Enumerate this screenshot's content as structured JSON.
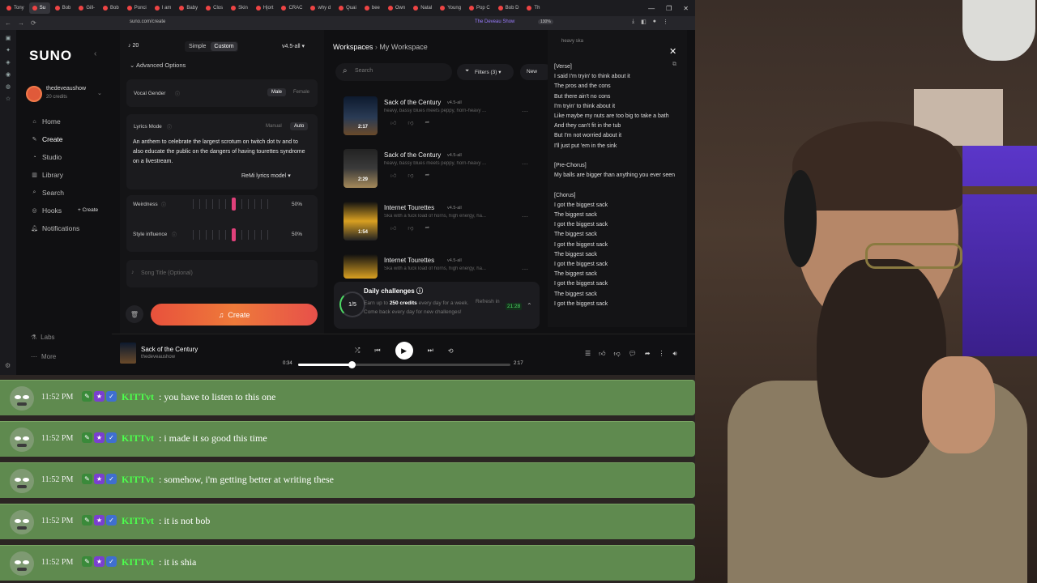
{
  "browser": {
    "tabs": [
      "Tony",
      "Su",
      "Bob",
      "Gill-",
      "Bob",
      "Ponci",
      "I am",
      "Baby",
      "Clos",
      "Skin",
      "Hjort",
      "CRAC",
      "why d",
      "Quai",
      "bee",
      "Own",
      "Natal",
      "Young",
      "Pop C",
      "Bob D",
      "Th"
    ],
    "url": "suno.com/create",
    "stream_tag": "The Deveau Show",
    "zoom": "130%"
  },
  "sidebar": {
    "logo": "SUNO",
    "username": "thedeveaushow",
    "credits": "20 credits",
    "nav": [
      {
        "label": "Home",
        "icon": "home-icon"
      },
      {
        "label": "Create",
        "icon": "create-icon"
      },
      {
        "label": "Studio",
        "icon": "studio-icon"
      },
      {
        "label": "Library",
        "icon": "library-icon"
      },
      {
        "label": "Search",
        "icon": "search-icon"
      },
      {
        "label": "Hooks",
        "icon": "hooks-icon"
      },
      {
        "label": "Notifications",
        "icon": "bell-icon"
      }
    ],
    "hooks_create": "+ Create",
    "labs": "Labs",
    "more": "More"
  },
  "create": {
    "credit_count": "20",
    "mode_simple": "Simple",
    "mode_custom": "Custom",
    "version": "v4.5-all",
    "advanced_options": "Advanced Options",
    "vocal_gender_label": "Vocal Gender",
    "vocal_male": "Male",
    "vocal_female": "Female",
    "lyrics_mode_label": "Lyrics Mode",
    "lyrics_manual": "Manual",
    "lyrics_auto": "Auto",
    "lyrics_prompt": "An anthem to celebrate the largest scrotum on twitch dot tv and to also educate the public on the dangers of having tourettes syndrome on a livestream.",
    "lyrics_model": "ReMi lyrics model",
    "weirdness_label": "Weirdness",
    "weirdness_value": "50%",
    "style_label": "Style influence",
    "style_value": "50%",
    "song_title_placeholder": "Song Title (Optional)",
    "create_button": "Create"
  },
  "workspace": {
    "breadcrumb_root": "Workspaces",
    "breadcrumb_current": "My Workspace",
    "search_placeholder": "Search",
    "filters": "Filters (3)",
    "new_button": "New",
    "tracks": [
      {
        "title": "Sack of the Century",
        "version": "v4.5-all",
        "desc": "heavy, bassy blues meets peppy, horn-heavy ...",
        "duration": "2:17"
      },
      {
        "title": "Sack of the Century",
        "version": "v4.5-all",
        "desc": "heavy, bassy blues meets peppy, horn-heavy ...",
        "duration": "2:29"
      },
      {
        "title": "Internet Tourettes",
        "version": "v4.5-all",
        "desc": "Ska with a fuck load of horns, high energy, ha...",
        "duration": "1:54"
      },
      {
        "title": "Internet Tourettes",
        "version": "v4.5-all",
        "desc": "Ska with a fuck load of horns, high energy, ha...",
        "duration": ""
      }
    ],
    "daily": {
      "title": "Daily challenges",
      "progress": "1/5",
      "desc_pre": "Earn up to",
      "desc_bold": "250 credits",
      "desc_post": "every day for a week. Come back every day for new challenges!",
      "refresh": "Refresh in",
      "timer": "21:28"
    }
  },
  "lyrics_panel": {
    "top_tag": "heavy ska",
    "text": "[Verse]\nI said I'm tryin' to think about it\nThe pros and the cons\nBut there ain't no cons\nI'm tryin' to think about it\nLike maybe my nuts are too big to take a bath\nAnd they can't fit in the tub\nBut I'm not worried about it\nI'll just put 'em in the sink\n\n[Pre-Chorus]\nMy balls are bigger than anything you ever seen\n\n[Chorus]\nI got the biggest sack\nThe biggest sack\nI got the biggest sack\nThe biggest sack\nI got the biggest sack\nThe biggest sack\nI got the biggest sack\nThe biggest sack\nI got the biggest sack\nThe biggest sack\nI got the biggest sack"
  },
  "player": {
    "title": "Sack of the Century",
    "artist": "thedeveaushow",
    "elapsed": "0:34",
    "total": "2:17",
    "progress_fraction": 0.25
  },
  "chat": {
    "messages": [
      {
        "time": "11:52 PM",
        "user": "KITTvt",
        "text": ": you have to listen to this one"
      },
      {
        "time": "11:52 PM",
        "user": "KITTvt",
        "text": ": i made it so good this time"
      },
      {
        "time": "11:52 PM",
        "user": "KITTvt",
        "text": ": somehow, i'm getting better at writing these"
      },
      {
        "time": "11:52 PM",
        "user": "KITTvt",
        "text": ": it is not bob"
      },
      {
        "time": "11:52 PM",
        "user": "KITTvt",
        "text": ": it is shia"
      }
    ]
  },
  "colors": {
    "accent": "#e8513c",
    "chat_bg": "#5f8a4f",
    "username": "#4dff4d",
    "slider": "#e0407a"
  }
}
